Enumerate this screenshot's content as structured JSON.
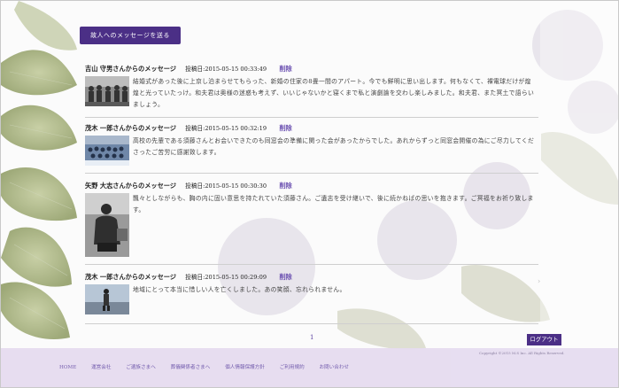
{
  "send_button": "故人へのメッセージを送る",
  "messages": [
    {
      "name": "吉山 守男さんからのメッセージ",
      "date_label": "投稿日:",
      "date": "2015-05-15 00:33:49",
      "delete": "削除",
      "body": "結婚式があった後に上京し泊まらせてもらった、新婚の住家の8畳一間のアパート。今でも鮮明に思い出します。何もなくて、裸電球だけが煌煌と光っていたっけ。和夫君は奥様の迷惑も考えず、いいじゃないかと寝くまで私と演劇論を交わし楽しみました。和夫君、また冥土で語らいましょう。"
    },
    {
      "name": "茂木 一郎さんからのメッセージ",
      "date_label": "投稿日:",
      "date": "2015-05-15 00:32:19",
      "delete": "削除",
      "body": "高校の先輩である須藤さんとお会いできたのも同窓会の準備に関った会があったからでした。あれからずっと同窓会開催の為にご尽力してくださったご苦労に感謝致します。"
    },
    {
      "name": "矢野 大志さんからのメッセージ",
      "date_label": "投稿日:",
      "date": "2015-05-15 00:30:30",
      "delete": "削除",
      "body": "飄々としながらも、胸の内に固い意思を持たれていた須藤さん。ご遺志を受け継いで、後に続かねばの思いを抱きます。ご冥福をお祈り致します。"
    },
    {
      "name": "茂木 一郎さんからのメッセージ",
      "date_label": "投稿日:",
      "date": "2015-05-15 00:29:09",
      "delete": "削除",
      "body": "地域にとって本当に惜しい人を亡くしました。あの笑顔、忘れられません。"
    }
  ],
  "pagination": {
    "current": "1"
  },
  "logout": "ログアウト",
  "copyright": "Copyright ©2015 M.S Inc. All Rights Reserved.",
  "footer_nav": [
    "HOME",
    "運営会社",
    "ご遺族さまへ",
    "葬儀関係者さまへ",
    "個人情報保護方針",
    "ご利用規約",
    "お問い合わせ"
  ]
}
